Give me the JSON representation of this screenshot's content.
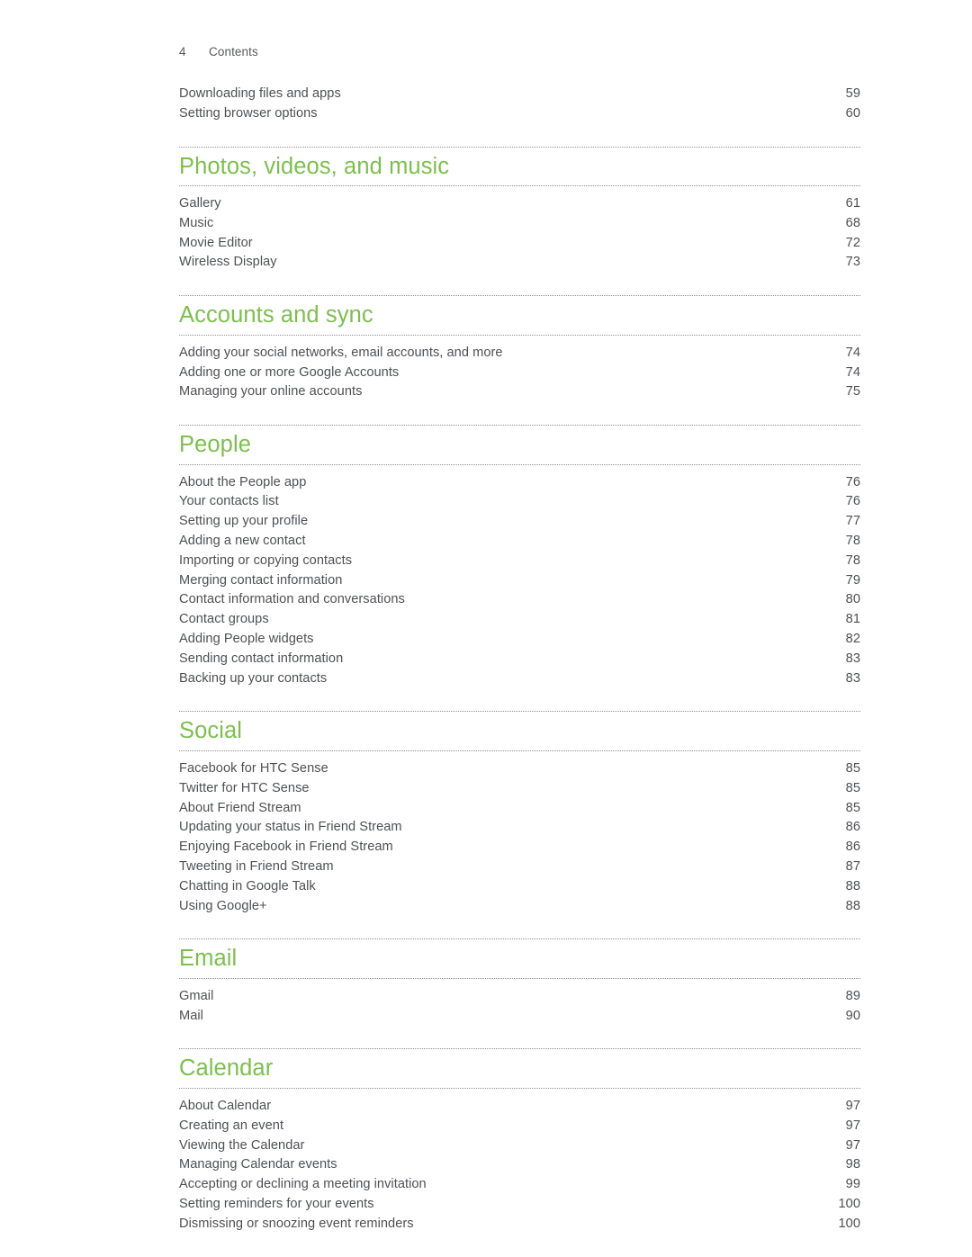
{
  "document": {
    "page_number": "4",
    "running_head": "Contents",
    "accent_color": "#7cbf4e",
    "text_color": "#4e5054",
    "rule_color": "#8b8d90",
    "background_color": "#ffffff"
  },
  "lead_entries": [
    {
      "label": "Downloading files and apps",
      "page": "59"
    },
    {
      "label": "Setting browser options",
      "page": "60"
    }
  ],
  "sections": [
    {
      "heading": "Photos, videos, and music",
      "entries": [
        {
          "label": "Gallery",
          "page": "61"
        },
        {
          "label": "Music",
          "page": "68"
        },
        {
          "label": "Movie Editor",
          "page": "72"
        },
        {
          "label": "Wireless Display",
          "page": "73"
        }
      ]
    },
    {
      "heading": "Accounts and sync",
      "entries": [
        {
          "label": "Adding your social networks, email accounts, and more",
          "page": "74"
        },
        {
          "label": "Adding one or more Google Accounts",
          "page": "74"
        },
        {
          "label": "Managing your online accounts",
          "page": "75"
        }
      ]
    },
    {
      "heading": "People",
      "entries": [
        {
          "label": "About the People app",
          "page": "76"
        },
        {
          "label": "Your contacts list",
          "page": "76"
        },
        {
          "label": "Setting up your profile",
          "page": "77"
        },
        {
          "label": "Adding a new contact",
          "page": "78"
        },
        {
          "label": "Importing or copying contacts",
          "page": "78"
        },
        {
          "label": "Merging contact information",
          "page": "79"
        },
        {
          "label": "Contact information and conversations",
          "page": "80"
        },
        {
          "label": "Contact groups",
          "page": "81"
        },
        {
          "label": "Adding People widgets",
          "page": "82"
        },
        {
          "label": "Sending contact information",
          "page": "83"
        },
        {
          "label": "Backing up your contacts",
          "page": "83"
        }
      ]
    },
    {
      "heading": "Social",
      "entries": [
        {
          "label": "Facebook for HTC Sense",
          "page": "85"
        },
        {
          "label": "Twitter for HTC Sense",
          "page": "85"
        },
        {
          "label": "About Friend Stream",
          "page": "85"
        },
        {
          "label": "Updating your status in Friend Stream",
          "page": "86"
        },
        {
          "label": "Enjoying Facebook in Friend Stream",
          "page": "86"
        },
        {
          "label": "Tweeting in Friend Stream",
          "page": "87"
        },
        {
          "label": "Chatting in Google Talk",
          "page": "88"
        },
        {
          "label": "Using Google+",
          "page": "88"
        }
      ]
    },
    {
      "heading": "Email",
      "entries": [
        {
          "label": "Gmail",
          "page": "89"
        },
        {
          "label": "Mail",
          "page": "90"
        }
      ]
    },
    {
      "heading": "Calendar",
      "entries": [
        {
          "label": "About Calendar",
          "page": "97"
        },
        {
          "label": "Creating an event",
          "page": "97"
        },
        {
          "label": "Viewing the Calendar",
          "page": "97"
        },
        {
          "label": "Managing Calendar events",
          "page": "98"
        },
        {
          "label": "Accepting or declining a meeting invitation",
          "page": "99"
        },
        {
          "label": "Setting reminders for your events",
          "page": "100"
        },
        {
          "label": "Dismissing or snoozing event reminders",
          "page": "100"
        }
      ]
    }
  ]
}
